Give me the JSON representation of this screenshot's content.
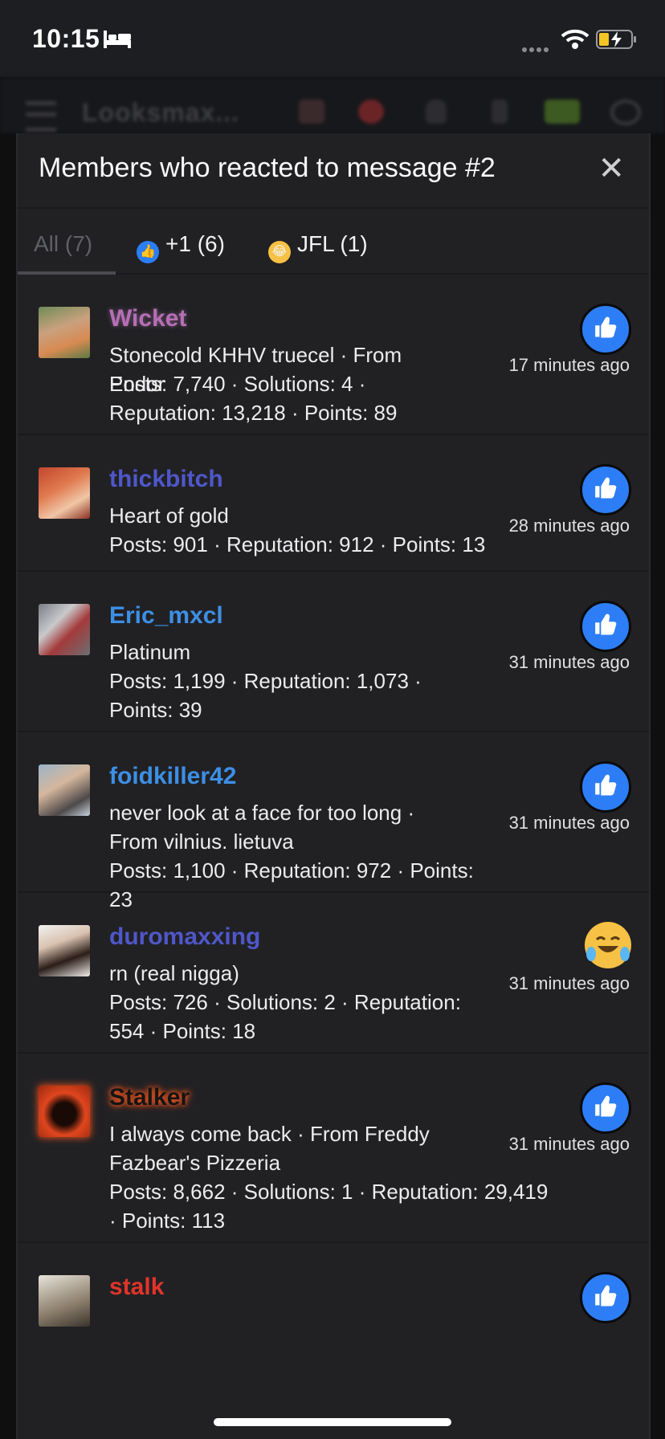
{
  "status_bar": {
    "time": "10:15"
  },
  "site_header": {
    "logo_text": "Looksmax..."
  },
  "modal": {
    "title": "Members who reacted to message #2",
    "close_label": "✕",
    "tabs": [
      {
        "label": "All (7)",
        "active": true
      },
      {
        "label": "+1 (6)",
        "icon": "thumbs-up-icon"
      },
      {
        "label": "JFL (1)",
        "icon": "laughing-crying-icon"
      }
    ],
    "members": [
      {
        "name": "Wicket",
        "name_color": "#b56fb5",
        "title": "Stonecold KHHV truecel · From Endor",
        "stats": "Posts: 7,740 · Solutions: 4 · Reputation: 13,218 · Points: 89",
        "time": "17 minutes ago",
        "reaction": "thumbs-up-icon"
      },
      {
        "name": "thickbitch",
        "name_color": "#4f57c9",
        "title": "Heart of gold",
        "stats": "Posts: 901 · Reputation: 912 · Points: 13",
        "time": "28 minutes ago",
        "reaction": "thumbs-up-icon"
      },
      {
        "name": "Eric_mxcl",
        "name_color": "#3d8fe6",
        "title": "Platinum",
        "stats": "Posts: 1,199 · Reputation: 1,073 · Points: 39",
        "time": "31 minutes ago",
        "reaction": "thumbs-up-icon"
      },
      {
        "name": "foidkiller42",
        "name_color": "#3d8fe6",
        "title": "never look at a face for too long · From vilnius. lietuva",
        "stats": "Posts: 1,100 · Reputation: 972 · Points: 23",
        "time": "31 minutes ago",
        "reaction": "thumbs-up-icon"
      },
      {
        "name": "duromaxxing",
        "name_color": "#4f57c9",
        "title": "rn (real nigga)",
        "stats": "Posts: 726 · Solutions: 2 · Reputation: 554 · Points: 18",
        "time": "31 minutes ago",
        "reaction": "laughing-crying-icon"
      },
      {
        "name": "Stalker",
        "name_color": "#141414",
        "title": "I always come back · From Freddy Fazbear's Pizzeria",
        "stats": "Posts: 8,662 · Solutions: 1 · Reputation: 29,419 · Points: 113",
        "time": "31 minutes ago",
        "reaction": "thumbs-up-icon"
      },
      {
        "name": "stalk",
        "name_color": "#e0342a",
        "reaction": "thumbs-up-icon"
      }
    ]
  }
}
